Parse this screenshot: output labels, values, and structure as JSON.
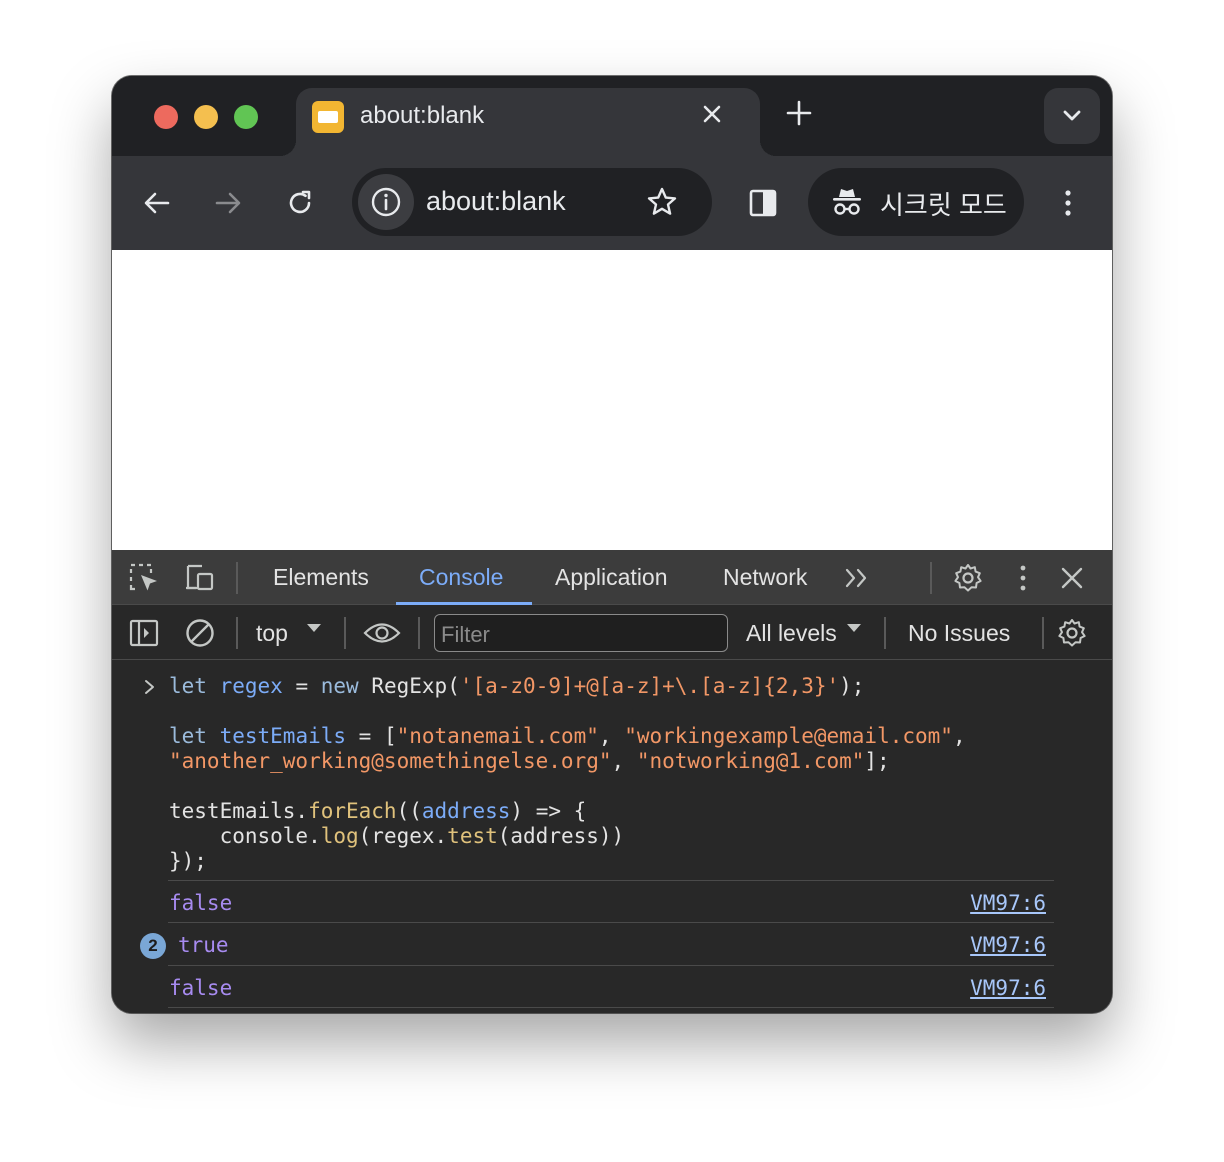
{
  "browser": {
    "tab": {
      "title": "about:blank"
    },
    "omnibox": {
      "url": "about:blank"
    },
    "incognito_label": "시크릿 모드"
  },
  "devtools": {
    "tabs": [
      {
        "label": "Elements",
        "active": false
      },
      {
        "label": "Console",
        "active": true
      },
      {
        "label": "Application",
        "active": false
      },
      {
        "label": "Network",
        "active": false
      }
    ],
    "console_toolbar": {
      "context": "top",
      "filter_placeholder": "Filter",
      "levels": "All levels",
      "issues": "No Issues"
    },
    "input_lines": [
      "let regex = new RegExp('[a-z0-9]+@[a-z]+\\.[a-z]{2,3}');",
      "",
      "let testEmails = [\"notanemail.com\", \"workingexample@email.com\",",
      "\"another_working@somethingelse.org\", \"notworking@1.com\"];",
      "",
      "testEmails.forEach((address) => {",
      "    console.log(regex.test(address))",
      "});"
    ],
    "output": [
      {
        "value": "false",
        "source": "VM97:6",
        "count": null
      },
      {
        "value": "true",
        "source": "VM97:6",
        "count": "2"
      },
      {
        "value": "false",
        "source": "VM97:6",
        "count": null
      }
    ]
  },
  "colors": {
    "window_bg": "#202124",
    "toolbar_bg": "#35363a",
    "devtools_bg": "#282828",
    "accent": "#7cacf8",
    "boolean": "#a78bf0",
    "string": "#f29766"
  }
}
